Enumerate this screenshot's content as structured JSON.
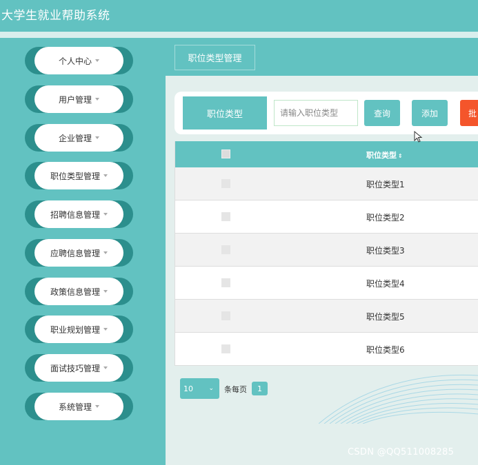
{
  "app": {
    "title": "大学生就业帮助系统"
  },
  "sidebar": {
    "items": [
      {
        "label": "个人中心"
      },
      {
        "label": "用户管理"
      },
      {
        "label": "企业管理"
      },
      {
        "label": "职位类型管理"
      },
      {
        "label": "招聘信息管理"
      },
      {
        "label": "应聘信息管理"
      },
      {
        "label": "政策信息管理"
      },
      {
        "label": "职业规划管理"
      },
      {
        "label": "面试技巧管理"
      },
      {
        "label": "系统管理"
      }
    ]
  },
  "breadcrumb": {
    "current": "职位类型管理"
  },
  "search": {
    "label": "职位类型",
    "placeholder": "请输入职位类型",
    "query_label": "查询",
    "add_label": "添加",
    "batch_label": "批"
  },
  "table": {
    "header": {
      "column": "职位类型",
      "sort_icon": "⇕"
    },
    "rows": [
      {
        "name": "职位类型1"
      },
      {
        "name": "职位类型2"
      },
      {
        "name": "职位类型3"
      },
      {
        "name": "职位类型4"
      },
      {
        "name": "职位类型5"
      },
      {
        "name": "职位类型6"
      }
    ]
  },
  "pager": {
    "page_size": "10",
    "per_page_label": "条每页",
    "current_page": "1"
  },
  "watermark": "CSDN @QQ511008285",
  "colors": {
    "accent": "#62c2c1",
    "accent_dark": "#2c8f8d",
    "danger": "#f4552b"
  }
}
